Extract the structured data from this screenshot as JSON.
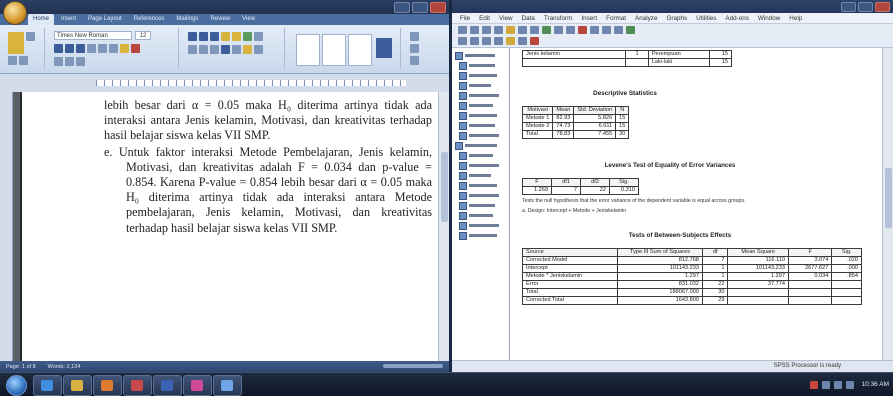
{
  "word": {
    "font_name": "Times New Roman",
    "font_size": "12",
    "tabs": [
      "Home",
      "Insert",
      "Page Layout",
      "References",
      "Mailings",
      "Review",
      "View"
    ],
    "paragraphs": [
      "lebih besar dari α = 0.05 maka H₀ diterima artinya tidak ada interaksi antara Jenis kelamin, Motivasi, dan kreativitas terhadap hasil belajar siswa kelas VII SMP.",
      "e. Untuk faktor interaksi Metode Pembelajaran, Jenis kelamin, Motivasi, dan kreativitas adalah F = 0.034 dan p-value = 0.854. Karena P-value = 0.854 lebih besar dari α = 0.05 maka H₀ diterima artinya tidak ada interaksi antara Metode pembelajaran, Jenis kelamin, Motivasi, dan kreativitas terhadap hasil belajar siswa kelas VII SMP."
    ],
    "status": [
      "Page: 1 of 8",
      "Words: 2,134"
    ]
  },
  "spss": {
    "menu": [
      "File",
      "Edit",
      "View",
      "Data",
      "Transform",
      "Insert",
      "Format",
      "Analyze",
      "Graphs",
      "Utilities",
      "Add-ons",
      "Window",
      "Help"
    ],
    "status": "SPSS Processor is ready",
    "top_table": {
      "rows": [
        [
          "Jenis kelamin",
          "1",
          "Perempuan",
          "15"
        ],
        [
          "",
          "",
          "Laki-laki",
          "15"
        ]
      ]
    },
    "descriptives": {
      "title": "Descriptive Statistics",
      "header": [
        "Motivasi",
        "Mean",
        "Std. Deviation",
        "N"
      ],
      "rows": [
        [
          "Metode 1",
          "82.93",
          "5.826",
          "15"
        ],
        [
          "Metode 2",
          "74.73",
          "6.611",
          "15"
        ],
        [
          "Total",
          "78.83",
          "7.455",
          "30"
        ]
      ]
    },
    "levene": {
      "title": "Levene's Test of Equality of Error Variances",
      "header": [
        "F",
        "df1",
        "df2",
        "Sig."
      ],
      "rows": [
        [
          "1.269",
          "7",
          "22",
          "0.310"
        ]
      ],
      "notes": [
        "Tests the null hypothesis that the error variance of the dependent variable is equal across groups.",
        "a. Design: Intercept + Metode + Jeniskelamin"
      ]
    },
    "anova": {
      "title": "Tests of Between-Subjects Effects",
      "header": [
        "Source",
        "Type III Sum of Squares",
        "df",
        "Mean Square",
        "F",
        "Sig."
      ],
      "rows": [
        [
          "Corrected Model",
          "812.768",
          "7",
          "116.110",
          "3.074",
          ".020"
        ],
        [
          "Intercept",
          "101143.233",
          "1",
          "101143.233",
          "2677.627",
          ".000"
        ],
        [
          "Metode * Jeniskelamin",
          "1.297",
          "1",
          "1.297",
          "0.034",
          ".854"
        ],
        [
          "Error",
          "831.032",
          "22",
          "37.774",
          "",
          ""
        ],
        [
          "Total",
          "188067.000",
          "30",
          "",
          "",
          ""
        ],
        [
          "Corrected Total",
          "1643.800",
          "29",
          "",
          "",
          ""
        ]
      ]
    }
  },
  "taskbar": {
    "clock": "10:36 AM"
  }
}
